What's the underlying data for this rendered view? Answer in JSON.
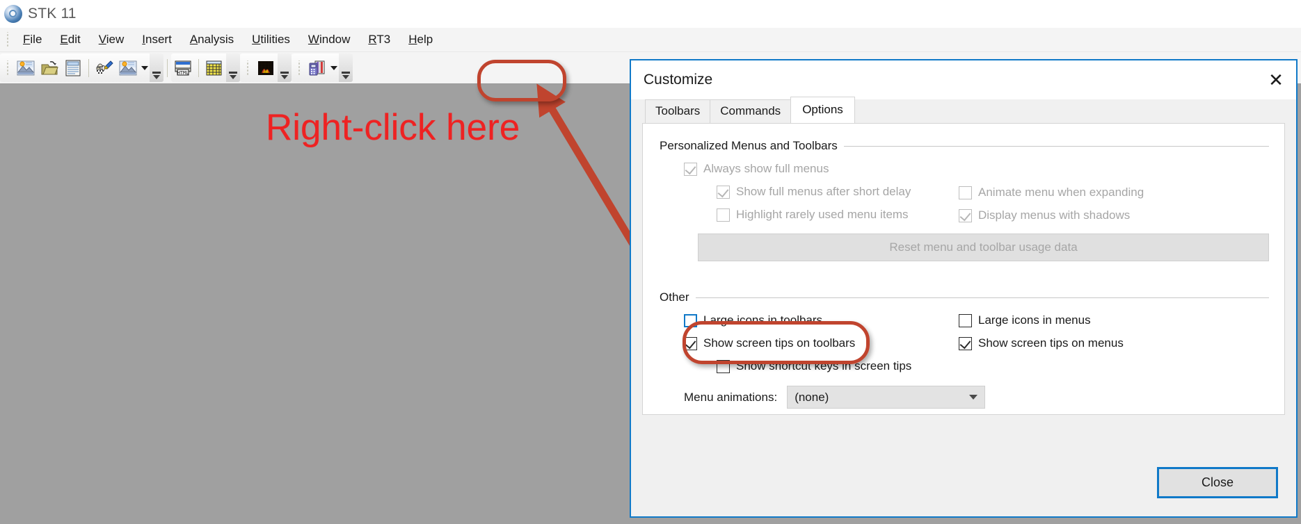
{
  "app": {
    "title": "STK 11",
    "logo_icon": "stk-logo-icon"
  },
  "menubar": {
    "items": [
      {
        "label": "File",
        "mnemonic": "F"
      },
      {
        "label": "Edit",
        "mnemonic": "E"
      },
      {
        "label": "View",
        "mnemonic": "V"
      },
      {
        "label": "Insert",
        "mnemonic": "I"
      },
      {
        "label": "Analysis",
        "mnemonic": "A"
      },
      {
        "label": "Utilities",
        "mnemonic": "U"
      },
      {
        "label": "Window",
        "mnemonic": "W"
      },
      {
        "label": "RT3",
        "mnemonic": "R"
      },
      {
        "label": "Help",
        "mnemonic": "H"
      }
    ]
  },
  "toolbar": {
    "buttons": [
      {
        "name": "new-scenario-icon"
      },
      {
        "name": "open-scenario-icon"
      },
      {
        "name": "save-scenario-icon"
      },
      {
        "name": "insert-object-icon"
      },
      {
        "name": "new-3d-window-icon"
      },
      {
        "name": "html-report-icon"
      },
      {
        "name": "data-grid-icon"
      },
      {
        "name": "analysis-workbench-icon"
      },
      {
        "name": "object-catalog-icon"
      }
    ]
  },
  "annotations": {
    "callout_text": "Right-click here",
    "callout_color": "#ee2222",
    "arrow_color": "#c0442e",
    "highlight_color": "#c0442e"
  },
  "dialog": {
    "title": "Customize",
    "close_icon": "close-icon",
    "tabs": [
      {
        "label": "Toolbars",
        "active": false
      },
      {
        "label": "Commands",
        "active": false
      },
      {
        "label": "Options",
        "active": true
      }
    ],
    "groups": [
      {
        "legend": "Personalized Menus and Toolbars",
        "left_items": [
          {
            "label": "Always show full menus",
            "checked": true,
            "disabled": true,
            "indent": 0
          },
          {
            "label": "Show full menus after short delay",
            "checked": true,
            "disabled": true,
            "indent": 1
          },
          {
            "label": "Highlight rarely used menu items",
            "checked": false,
            "disabled": true,
            "indent": 1
          }
        ],
        "right_items": [
          {
            "label": "Animate menu when expanding",
            "checked": false,
            "disabled": true
          },
          {
            "label": "Display menus with shadows",
            "checked": true,
            "disabled": true
          }
        ],
        "button": {
          "label": "Reset menu and toolbar usage data",
          "disabled": true
        }
      },
      {
        "legend": "Other",
        "left_items": [
          {
            "label": "Large icons in toolbars",
            "checked": false,
            "disabled": false,
            "indent": 0,
            "focused": true
          },
          {
            "label": "Show screen tips on toolbars",
            "checked": true,
            "disabled": false,
            "indent": 0
          },
          {
            "label": "Show shortcut keys in screen tips",
            "checked": false,
            "disabled": false,
            "indent": 1
          }
        ],
        "right_items": [
          {
            "label": "Large icons in menus",
            "checked": false,
            "disabled": false
          },
          {
            "label": "Show screen tips on menus",
            "checked": true,
            "disabled": false
          }
        ],
        "select": {
          "label": "Menu animations:",
          "value": "(none)",
          "chevron_icon": "chevron-down-icon"
        }
      }
    ],
    "footer": {
      "close_label": "Close"
    }
  }
}
